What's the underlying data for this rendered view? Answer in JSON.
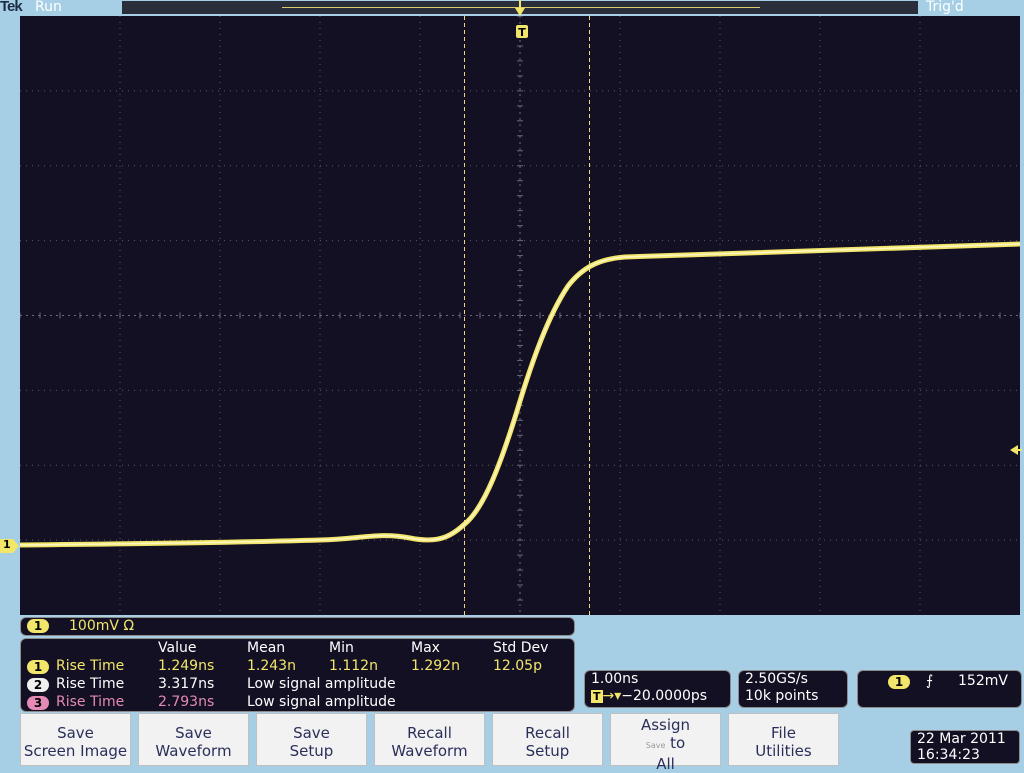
{
  "brand": "Tek",
  "run_state": "Run",
  "trigger_state": "Trig'd",
  "trigger_position_marker": "T",
  "channel_marker": "1",
  "trigger_level_marker": "◂",
  "channel_readout": {
    "channel": "1",
    "scale": "100mV Ω"
  },
  "measurements": {
    "headers": {
      "value": "Value",
      "mean": "Mean",
      "min": "Min",
      "max": "Max",
      "std": "Std Dev"
    },
    "rows": [
      {
        "channel": "1",
        "name": "Rise Time",
        "value": "1.249ns",
        "mean": "1.243n",
        "min": "1.112n",
        "max": "1.292n",
        "std": "12.05p",
        "color": "#f2e66a"
      },
      {
        "channel": "2",
        "name": "Rise Time",
        "value": "3.317ns",
        "status": "Low signal amplitude",
        "color": "#ffffff"
      },
      {
        "channel": "3",
        "name": "Rise Time",
        "value": "2.793ns",
        "status": "Low signal amplitude",
        "color": "#e48ab4"
      }
    ]
  },
  "horizontal": {
    "scale": "1.00ns",
    "trigger_tag": "T",
    "arrow": "→▾",
    "position": "−20.0000ps"
  },
  "sampling": {
    "rate": "2.50GS/s",
    "record": "10k points"
  },
  "trigger": {
    "source": "1",
    "slope": "⨍",
    "level": "152mV"
  },
  "softkeys": [
    {
      "line1": "Save",
      "line2": "Screen Image"
    },
    {
      "line1": "Save",
      "line2": "Waveform"
    },
    {
      "line1": "Save",
      "line2": "Setup"
    },
    {
      "line1": "Recall",
      "line2": "Waveform"
    },
    {
      "line1": "Recall",
      "line2": "Setup"
    },
    {
      "line1": "Assign",
      "tiny": "Save",
      "line2": "to",
      "line3": "All"
    },
    {
      "line1": "File",
      "line2": "Utilities"
    }
  ],
  "datetime": {
    "date": "22 Mar 2011",
    "time": "16:34:23"
  },
  "colors": {
    "ch1": "#f2e66a",
    "ch2": "#ffffff",
    "ch3": "#e48ab4",
    "graticule_bg": "#141024",
    "bezel": "#a6cfe6",
    "softkey_text": "#2a2f5a"
  }
}
